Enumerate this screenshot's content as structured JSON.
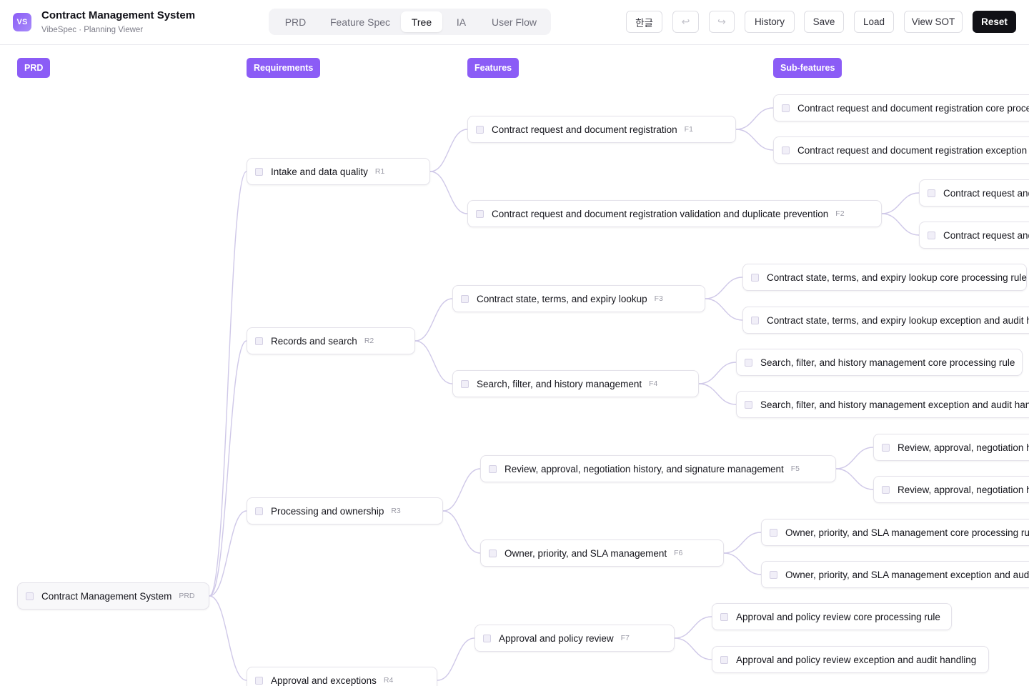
{
  "app": {
    "logo_text": "VS",
    "title": "Contract Management System",
    "subtitle": "VibeSpec · Planning Viewer"
  },
  "tabs": [
    {
      "label": "PRD",
      "active": false
    },
    {
      "label": "Feature Spec",
      "active": false
    },
    {
      "label": "Tree",
      "active": true
    },
    {
      "label": "IA",
      "active": false
    },
    {
      "label": "User Flow",
      "active": false
    }
  ],
  "toolbar": {
    "lang_label": "한글",
    "undo_icon": "undo-icon",
    "redo_icon": "redo-icon",
    "undo_glyph": "↩",
    "redo_glyph": "↪",
    "history_label": "History",
    "save_label": "Save",
    "load_label": "Load",
    "view_sot_label": "View SOT",
    "reset_label": "Reset"
  },
  "colors": {
    "accent": "#8b5cf6",
    "edge": "#cfc8e8",
    "dark_button": "#111116"
  },
  "columns": {
    "prd": "PRD",
    "requirements": "Requirements",
    "features": "Features",
    "subfeatures": "Sub-features"
  },
  "tree": {
    "root": {
      "label": "Contract Management System",
      "code": "PRD"
    },
    "requirements": [
      {
        "label": "Intake and data quality",
        "code": "R1"
      },
      {
        "label": "Records and search",
        "code": "R2"
      },
      {
        "label": "Processing and ownership",
        "code": "R3"
      },
      {
        "label": "Approval and exceptions",
        "code": "R4"
      }
    ],
    "features": [
      {
        "label": "Contract request and document registration",
        "code": "F1"
      },
      {
        "label": "Contract request and document registration validation and duplicate prevention",
        "code": "F2"
      },
      {
        "label": "Contract state, terms, and expiry lookup",
        "code": "F3"
      },
      {
        "label": "Search, filter, and history management",
        "code": "F4"
      },
      {
        "label": "Review, approval, negotiation history, and signature management",
        "code": "F5"
      },
      {
        "label": "Owner, priority, and SLA management",
        "code": "F6"
      },
      {
        "label": "Approval and policy review",
        "code": "F7"
      }
    ],
    "subfeatures": [
      {
        "label": "Contract request and document registration core processing rule"
      },
      {
        "label": "Contract request and document registration exception and audit handling"
      },
      {
        "label": "Contract request and document registration validation and duplicate prevention core processing rule"
      },
      {
        "label": "Contract request and document registration validation and duplicate prevention exception and audit handling"
      },
      {
        "label": "Contract state, terms, and expiry lookup core processing rule"
      },
      {
        "label": "Contract state, terms, and expiry lookup exception and audit handling"
      },
      {
        "label": "Search, filter, and history management core processing rule"
      },
      {
        "label": "Search, filter, and history management exception and audit handling"
      },
      {
        "label": "Review, approval, negotiation history, and signature management core processing rule"
      },
      {
        "label": "Review, approval, negotiation history, and signature management exception and audit handling"
      },
      {
        "label": "Owner, priority, and SLA management core processing rule"
      },
      {
        "label": "Owner, priority, and SLA management exception and audit handling"
      },
      {
        "label": "Approval and policy review core processing rule"
      },
      {
        "label": "Approval and policy review exception and audit handling"
      }
    ]
  }
}
